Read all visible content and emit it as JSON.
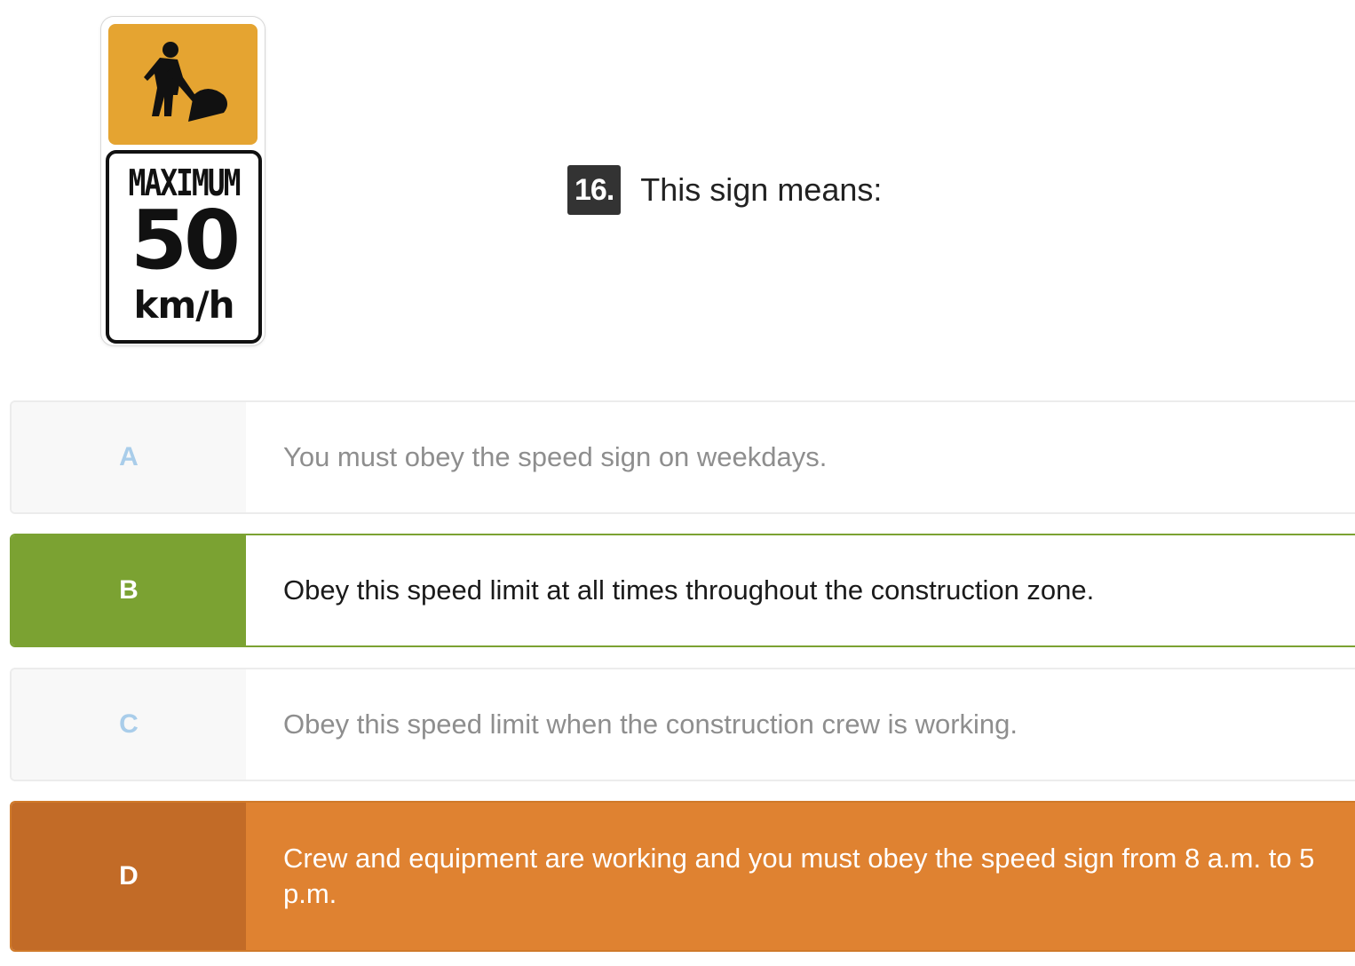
{
  "sign": {
    "top_icon": "construction-worker-icon",
    "line1": "MAXIMUM",
    "number": "50",
    "unit": "km/h",
    "colors": {
      "top_panel": "#e5a431",
      "border": "#111111"
    }
  },
  "question": {
    "number": "16.",
    "text": "This sign means:"
  },
  "options": [
    {
      "letter": "A",
      "text": "You must obey the speed sign on weekdays.",
      "state": "default"
    },
    {
      "letter": "B",
      "text": "Obey this speed limit at all times throughout the construction zone.",
      "state": "correct"
    },
    {
      "letter": "C",
      "text": "Obey this speed limit when the construction crew is working.",
      "state": "default"
    },
    {
      "letter": "D",
      "text": "Crew and equipment are working and you must obey the speed sign from 8 a.m. to 5 p.m.",
      "state": "selected-incorrect"
    }
  ],
  "colors": {
    "correct": "#7ba232",
    "incorrect": "#df8231",
    "letter_default": "#a9cdea"
  }
}
